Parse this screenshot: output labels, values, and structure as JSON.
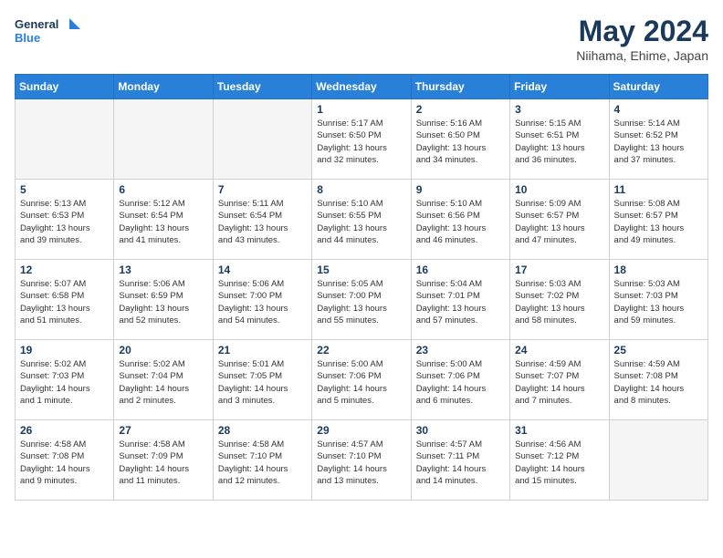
{
  "header": {
    "logo_line1": "General",
    "logo_line2": "Blue",
    "month_title": "May 2024",
    "location": "Niihama, Ehime, Japan"
  },
  "days_of_week": [
    "Sunday",
    "Monday",
    "Tuesday",
    "Wednesday",
    "Thursday",
    "Friday",
    "Saturday"
  ],
  "weeks": [
    {
      "days": [
        {
          "number": "",
          "info": "",
          "empty": true
        },
        {
          "number": "",
          "info": "",
          "empty": true
        },
        {
          "number": "",
          "info": "",
          "empty": true
        },
        {
          "number": "1",
          "info": "Sunrise: 5:17 AM\nSunset: 6:50 PM\nDaylight: 13 hours\nand 32 minutes."
        },
        {
          "number": "2",
          "info": "Sunrise: 5:16 AM\nSunset: 6:50 PM\nDaylight: 13 hours\nand 34 minutes."
        },
        {
          "number": "3",
          "info": "Sunrise: 5:15 AM\nSunset: 6:51 PM\nDaylight: 13 hours\nand 36 minutes."
        },
        {
          "number": "4",
          "info": "Sunrise: 5:14 AM\nSunset: 6:52 PM\nDaylight: 13 hours\nand 37 minutes."
        }
      ]
    },
    {
      "days": [
        {
          "number": "5",
          "info": "Sunrise: 5:13 AM\nSunset: 6:53 PM\nDaylight: 13 hours\nand 39 minutes."
        },
        {
          "number": "6",
          "info": "Sunrise: 5:12 AM\nSunset: 6:54 PM\nDaylight: 13 hours\nand 41 minutes."
        },
        {
          "number": "7",
          "info": "Sunrise: 5:11 AM\nSunset: 6:54 PM\nDaylight: 13 hours\nand 43 minutes."
        },
        {
          "number": "8",
          "info": "Sunrise: 5:10 AM\nSunset: 6:55 PM\nDaylight: 13 hours\nand 44 minutes."
        },
        {
          "number": "9",
          "info": "Sunrise: 5:10 AM\nSunset: 6:56 PM\nDaylight: 13 hours\nand 46 minutes."
        },
        {
          "number": "10",
          "info": "Sunrise: 5:09 AM\nSunset: 6:57 PM\nDaylight: 13 hours\nand 47 minutes."
        },
        {
          "number": "11",
          "info": "Sunrise: 5:08 AM\nSunset: 6:57 PM\nDaylight: 13 hours\nand 49 minutes."
        }
      ]
    },
    {
      "days": [
        {
          "number": "12",
          "info": "Sunrise: 5:07 AM\nSunset: 6:58 PM\nDaylight: 13 hours\nand 51 minutes."
        },
        {
          "number": "13",
          "info": "Sunrise: 5:06 AM\nSunset: 6:59 PM\nDaylight: 13 hours\nand 52 minutes."
        },
        {
          "number": "14",
          "info": "Sunrise: 5:06 AM\nSunset: 7:00 PM\nDaylight: 13 hours\nand 54 minutes."
        },
        {
          "number": "15",
          "info": "Sunrise: 5:05 AM\nSunset: 7:00 PM\nDaylight: 13 hours\nand 55 minutes."
        },
        {
          "number": "16",
          "info": "Sunrise: 5:04 AM\nSunset: 7:01 PM\nDaylight: 13 hours\nand 57 minutes."
        },
        {
          "number": "17",
          "info": "Sunrise: 5:03 AM\nSunset: 7:02 PM\nDaylight: 13 hours\nand 58 minutes."
        },
        {
          "number": "18",
          "info": "Sunrise: 5:03 AM\nSunset: 7:03 PM\nDaylight: 13 hours\nand 59 minutes."
        }
      ]
    },
    {
      "days": [
        {
          "number": "19",
          "info": "Sunrise: 5:02 AM\nSunset: 7:03 PM\nDaylight: 14 hours\nand 1 minute."
        },
        {
          "number": "20",
          "info": "Sunrise: 5:02 AM\nSunset: 7:04 PM\nDaylight: 14 hours\nand 2 minutes."
        },
        {
          "number": "21",
          "info": "Sunrise: 5:01 AM\nSunset: 7:05 PM\nDaylight: 14 hours\nand 3 minutes."
        },
        {
          "number": "22",
          "info": "Sunrise: 5:00 AM\nSunset: 7:06 PM\nDaylight: 14 hours\nand 5 minutes."
        },
        {
          "number": "23",
          "info": "Sunrise: 5:00 AM\nSunset: 7:06 PM\nDaylight: 14 hours\nand 6 minutes."
        },
        {
          "number": "24",
          "info": "Sunrise: 4:59 AM\nSunset: 7:07 PM\nDaylight: 14 hours\nand 7 minutes."
        },
        {
          "number": "25",
          "info": "Sunrise: 4:59 AM\nSunset: 7:08 PM\nDaylight: 14 hours\nand 8 minutes."
        }
      ]
    },
    {
      "days": [
        {
          "number": "26",
          "info": "Sunrise: 4:58 AM\nSunset: 7:08 PM\nDaylight: 14 hours\nand 9 minutes."
        },
        {
          "number": "27",
          "info": "Sunrise: 4:58 AM\nSunset: 7:09 PM\nDaylight: 14 hours\nand 11 minutes."
        },
        {
          "number": "28",
          "info": "Sunrise: 4:58 AM\nSunset: 7:10 PM\nDaylight: 14 hours\nand 12 minutes."
        },
        {
          "number": "29",
          "info": "Sunrise: 4:57 AM\nSunset: 7:10 PM\nDaylight: 14 hours\nand 13 minutes."
        },
        {
          "number": "30",
          "info": "Sunrise: 4:57 AM\nSunset: 7:11 PM\nDaylight: 14 hours\nand 14 minutes."
        },
        {
          "number": "31",
          "info": "Sunrise: 4:56 AM\nSunset: 7:12 PM\nDaylight: 14 hours\nand 15 minutes."
        },
        {
          "number": "",
          "info": "",
          "empty": true
        }
      ]
    }
  ]
}
